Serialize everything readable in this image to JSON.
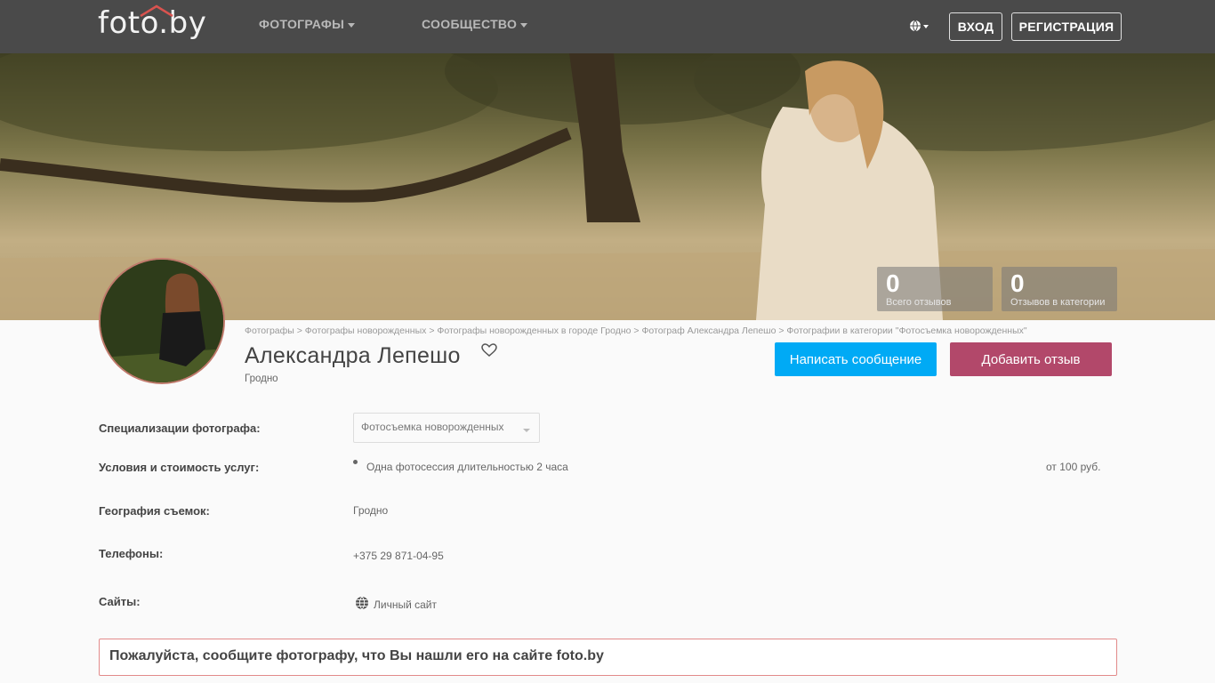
{
  "header": {
    "logo": "foto.by",
    "nav": [
      {
        "label": "ФОТОГРАФЫ"
      },
      {
        "label": "СООБЩЕСТВО"
      }
    ],
    "login_label": "ВХОД",
    "register_label": "РЕГИСТРАЦИЯ"
  },
  "stats": [
    {
      "value": "0",
      "label": "Всего отзывов"
    },
    {
      "value": "0",
      "label": "Отзывов в категории"
    }
  ],
  "breadcrumb": "Фотографы > Фотографы новорожденных > Фотографы новорожденных в городе Гродно > Фотограф Александра Лепешо > Фотографии в категории \"Фотосъемка новорожденных\"",
  "profile": {
    "name": "Александра Лепешо",
    "city": "Гродно",
    "write_message_label": "Написать сообщение",
    "add_review_label": "Добавить отзыв"
  },
  "info": {
    "specializations_label": "Специализации фотографа:",
    "specialization_selected": "Фотосъемка новорожденных",
    "services_label": "Условия и стоимость услуг:",
    "service_item": "Одна фотосессия длительностью 2 часа",
    "service_price": "от 100 руб.",
    "geography_label": "География съемок:",
    "geography_value": "Гродно",
    "phones_label": "Телефоны:",
    "phone_value": "+375 29 871-04-95",
    "sites_label": "Сайты:",
    "site_value": "Личный сайт"
  },
  "notice": "Пожалуйста, сообщите фотографу, что Вы нашли его на сайте foto.by",
  "colors": {
    "topbar": "#4a4a4a",
    "message_button": "#00aaf5",
    "review_button": "#b2486a",
    "notice_border": "#e28a8a"
  }
}
